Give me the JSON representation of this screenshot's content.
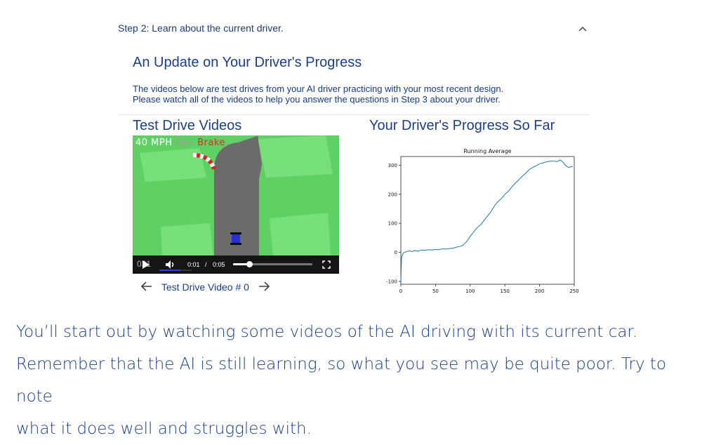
{
  "step": {
    "header": "Step 2: Learn about the current driver.",
    "expanded": true,
    "chevron": "chevron-up-icon"
  },
  "card": {
    "title": "An Update on Your Driver's Progress",
    "description_line1": "The videos below are test drives from your AI driver practicing with your most recent design.",
    "description_line2": "Please watch all of the videos to help you answer the questions in Step 3 about your driver."
  },
  "videos": {
    "title": "Test Drive Videos",
    "hud_speed": "40 MPH",
    "hud_gas": "Gas",
    "hud_brake": "Brake",
    "overlay_counter": "031",
    "current_time": "0:01",
    "time_sep": "/",
    "duration": "0:05",
    "progress": 0.2,
    "nav_label": "Test Drive Video # 0"
  },
  "progress_chart": {
    "title": "Your Driver's Progress So Far"
  },
  "chart_data": {
    "type": "line",
    "title": "Running Average",
    "xlabel": "",
    "ylabel": "",
    "xlim": [
      0,
      250
    ],
    "ylim": [
      -110,
      330
    ],
    "xticks": [
      0,
      50,
      100,
      150,
      200,
      250
    ],
    "yticks": [
      -100,
      0,
      100,
      200,
      300
    ],
    "grid": false,
    "series": [
      {
        "color": "#1f77b4",
        "x": [
          0,
          1,
          2,
          3,
          5,
          8,
          12,
          16,
          20,
          25,
          30,
          35,
          40,
          45,
          50,
          55,
          60,
          65,
          70,
          75,
          80,
          85,
          90,
          95,
          100,
          105,
          110,
          115,
          120,
          125,
          130,
          135,
          140,
          145,
          150,
          155,
          160,
          165,
          170,
          175,
          180,
          185,
          190,
          195,
          200,
          205,
          210,
          215,
          220,
          225,
          230,
          234,
          238,
          242,
          245,
          248
        ],
        "y": [
          -100,
          -20,
          -10,
          -5,
          0,
          2,
          5,
          3,
          6,
          4,
          8,
          7,
          9,
          8,
          10,
          9,
          12,
          11,
          13,
          14,
          18,
          20,
          25,
          38,
          55,
          70,
          85,
          95,
          110,
          125,
          140,
          160,
          175,
          185,
          200,
          210,
          225,
          238,
          250,
          262,
          272,
          285,
          292,
          298,
          305,
          308,
          312,
          314,
          315,
          312,
          318,
          310,
          298,
          292,
          295,
          296
        ]
      }
    ]
  },
  "caption": {
    "line1": "You’ll start out by watching some videos of the AI driving with its current car.",
    "line2": "Remember that the AI is still learning, so what you see may be quite poor. Try to note",
    "line3": "what it does well and struggles with."
  }
}
